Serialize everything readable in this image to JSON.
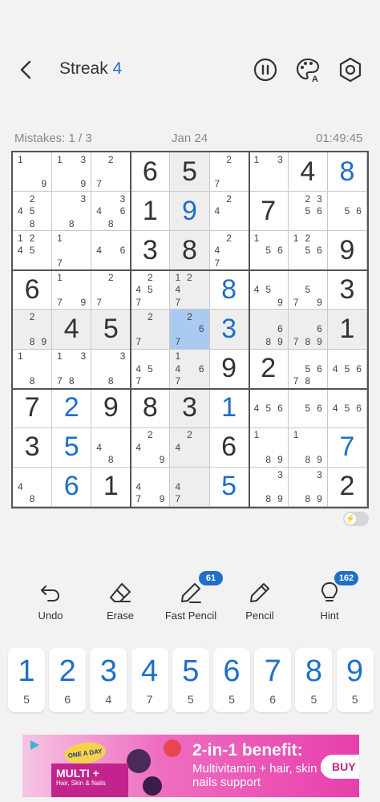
{
  "header": {
    "title": "Streak",
    "streak": "4"
  },
  "status": {
    "mistakes": "Mistakes: 1 / 3",
    "date": "Jan 24",
    "timer": "01:49:45"
  },
  "colors": {
    "accent": "#1f6fc8",
    "highlight": "#eeeeee",
    "selected": "#a9cbf2"
  },
  "selected_cell": [
    4,
    4
  ],
  "highlight_row": 4,
  "highlight_col": 4,
  "board": [
    [
      {
        "n": [
          1,
          9
        ]
      },
      {
        "n": [
          1,
          3,
          9
        ]
      },
      {
        "n": [
          2,
          7
        ]
      },
      {
        "v": 6
      },
      {
        "v": 5
      },
      {
        "n": [
          2,
          7
        ]
      },
      {
        "n": [
          1,
          3
        ]
      },
      {
        "v": 4
      },
      {
        "v": 8,
        "u": true
      }
    ],
    [
      {
        "n": [
          2,
          4,
          5,
          8
        ]
      },
      {
        "n": [
          3,
          8
        ]
      },
      {
        "n": [
          3,
          4,
          6,
          8
        ]
      },
      {
        "v": 1
      },
      {
        "v": 9,
        "u": true
      },
      {
        "n": [
          2,
          4
        ]
      },
      {
        "v": 7
      },
      {
        "n": [
          2,
          3,
          5,
          6
        ]
      },
      {
        "n": [
          5,
          6
        ]
      }
    ],
    [
      {
        "n": [
          1,
          2,
          4,
          5
        ]
      },
      {
        "n": [
          1,
          7
        ]
      },
      {
        "n": [
          4,
          6
        ]
      },
      {
        "v": 3
      },
      {
        "v": 8
      },
      {
        "n": [
          2,
          4,
          7
        ]
      },
      {
        "n": [
          1,
          5,
          6
        ]
      },
      {
        "n": [
          1,
          2,
          5,
          6
        ]
      },
      {
        "v": 9
      }
    ],
    [
      {
        "v": 6
      },
      {
        "n": [
          1,
          7,
          9
        ]
      },
      {
        "n": [
          2,
          7
        ]
      },
      {
        "n": [
          2,
          4,
          5,
          7
        ]
      },
      {
        "n": [
          1,
          2,
          4,
          7
        ]
      },
      {
        "v": 8,
        "u": true
      },
      {
        "n": [
          4,
          5,
          9
        ]
      },
      {
        "n": [
          5,
          7,
          9
        ]
      },
      {
        "v": 3
      }
    ],
    [
      {
        "n": [
          2,
          8,
          9
        ]
      },
      {
        "v": 4
      },
      {
        "v": 5
      },
      {
        "n": [
          2,
          7
        ]
      },
      {
        "n": [
          2,
          6,
          7
        ]
      },
      {
        "v": 3,
        "u": true
      },
      {
        "n": [
          6,
          8,
          9
        ]
      },
      {
        "n": [
          6,
          7,
          8,
          9
        ]
      },
      {
        "v": 1
      }
    ],
    [
      {
        "n": [
          1,
          8
        ]
      },
      {
        "n": [
          1,
          3,
          7,
          8
        ]
      },
      {
        "n": [
          3,
          8
        ]
      },
      {
        "n": [
          4,
          5,
          7
        ]
      },
      {
        "n": [
          1,
          4,
          6,
          7
        ]
      },
      {
        "v": 9
      },
      {
        "v": 2
      },
      {
        "n": [
          5,
          6,
          7,
          8
        ]
      },
      {
        "n": [
          4,
          5,
          6
        ]
      }
    ],
    [
      {
        "v": 7
      },
      {
        "v": 2,
        "u": true
      },
      {
        "v": 9
      },
      {
        "v": 8
      },
      {
        "v": 3
      },
      {
        "v": 1,
        "u": true
      },
      {
        "n": [
          4,
          5,
          6
        ]
      },
      {
        "n": [
          5,
          6
        ]
      },
      {
        "n": [
          4,
          5,
          6
        ]
      }
    ],
    [
      {
        "v": 3
      },
      {
        "v": 5,
        "u": true
      },
      {
        "n": [
          4,
          8
        ]
      },
      {
        "n": [
          2,
          4,
          9
        ]
      },
      {
        "n": [
          2,
          4
        ]
      },
      {
        "v": 6
      },
      {
        "n": [
          1,
          8,
          9
        ]
      },
      {
        "n": [
          1,
          8,
          9
        ]
      },
      {
        "v": 7,
        "u": true
      }
    ],
    [
      {
        "n": [
          4,
          8
        ]
      },
      {
        "v": 6,
        "u": true
      },
      {
        "v": 1
      },
      {
        "n": [
          4,
          7,
          9
        ]
      },
      {
        "n": [
          4,
          7
        ]
      },
      {
        "v": 5,
        "u": true
      },
      {
        "n": [
          3,
          8,
          9
        ]
      },
      {
        "n": [
          3,
          8,
          9
        ]
      },
      {
        "v": 2
      }
    ]
  ],
  "tools": {
    "undo": "Undo",
    "erase": "Erase",
    "fast_pencil": "Fast Pencil",
    "fast_pencil_badge": "61",
    "pencil": "Pencil",
    "hint": "Hint",
    "hint_badge": "162"
  },
  "numpad": [
    {
      "digit": "1",
      "count": "5"
    },
    {
      "digit": "2",
      "count": "6"
    },
    {
      "digit": "3",
      "count": "4"
    },
    {
      "digit": "4",
      "count": "7"
    },
    {
      "digit": "5",
      "count": "5"
    },
    {
      "digit": "6",
      "count": "5"
    },
    {
      "digit": "7",
      "count": "6"
    },
    {
      "digit": "8",
      "count": "5"
    },
    {
      "digit": "9",
      "count": "5"
    }
  ],
  "ad": {
    "brand": "ONE A DAY",
    "product": "MULTI +",
    "product_sub": "Hair, Skin & Nails",
    "headline": "2-in-1 benefit:",
    "body": "Multivitamin + hair, skin & nails support",
    "cta": "BUY N"
  }
}
